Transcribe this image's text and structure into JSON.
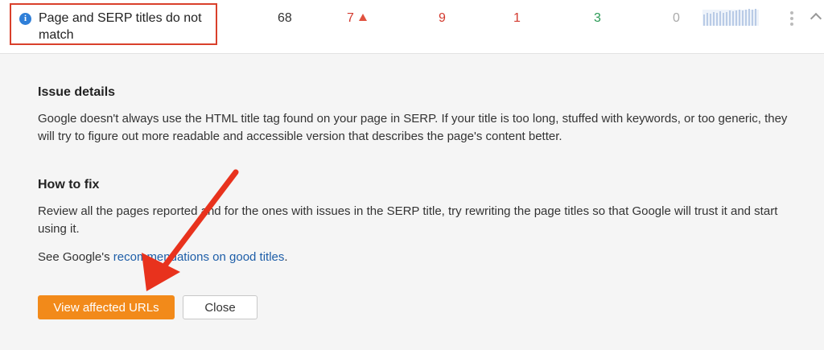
{
  "issue_row": {
    "title": "Page and SERP titles do not match",
    "info_icon_glyph": "i",
    "total": "68",
    "new": "7",
    "col_a": "9",
    "col_b": "1",
    "col_c": "3",
    "col_d": "0"
  },
  "details": {
    "heading": "Issue details",
    "text": "Google doesn't always use the HTML title tag found on your page in SERP. If your title is too long, stuffed with keywords, or too generic, they will try to figure out more readable and accessible version that describes the page's content better."
  },
  "how_to_fix": {
    "heading": "How to fix",
    "text": "Review all the pages reported and for the ones with issues in the SERP title, try rewriting the page titles so that Google will trust it and start using it.",
    "see_prefix": "See Google's ",
    "link_text": "recommendations on good titles",
    "see_suffix": "."
  },
  "buttons": {
    "primary": "View affected URLs",
    "secondary": "Close"
  },
  "colors": {
    "accent_orange": "#f28a1a",
    "annotation_red": "#e8321d",
    "link_blue": "#1e5ea8"
  }
}
